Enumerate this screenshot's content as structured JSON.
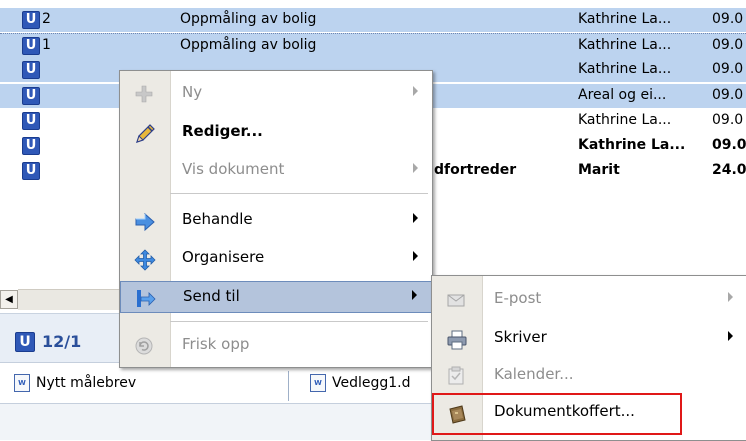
{
  "list": {
    "rows": [
      {
        "badge": "U",
        "num": "2",
        "title": "Oppmåling av bolig",
        "who": "Kathrine La...",
        "date": "09.0",
        "selected": true,
        "bold": false
      },
      {
        "badge": "U",
        "num": "1",
        "title": "Oppmåling av bolig",
        "who": "Kathrine La...",
        "date": "09.0",
        "selected": true,
        "bold": false
      },
      {
        "badge": "U",
        "num": "",
        "title": "",
        "who": "Kathrine La...",
        "date": "09.0",
        "selected": true,
        "bold": false
      },
      {
        "badge": "U",
        "num": "",
        "title": "",
        "who": "Areal og ei...",
        "date": "09.0",
        "selected": true,
        "bold": false
      },
      {
        "badge": "U",
        "num": "",
        "title": "",
        "who": "Kathrine La...",
        "date": "09.0",
        "selected": false,
        "bold": false
      },
      {
        "badge": "U",
        "num": "",
        "title": "",
        "who": "Kathrine La...",
        "date": "09.0",
        "selected": false,
        "bold": true
      },
      {
        "badge": "U",
        "num": "",
        "title": "dfortreder",
        "who": "Marit",
        "date": "24.0",
        "selected": false,
        "bold": true
      }
    ]
  },
  "lower": {
    "badge": "U",
    "number": "12/1",
    "attachments": [
      {
        "icon": "word-document-icon",
        "label": "Nytt målebrev"
      },
      {
        "icon": "word-document-icon",
        "label": "Vedlegg1.d"
      }
    ]
  },
  "context_menu": {
    "items": [
      {
        "name": "new",
        "icon": "plus-icon",
        "label": "Ny",
        "disabled": true,
        "submenu": true
      },
      {
        "name": "edit",
        "icon": "pencil-icon",
        "label": "Rediger...",
        "disabled": false,
        "strong": true,
        "submenu": false
      },
      {
        "name": "view-document",
        "icon": "",
        "label": "Vis dokument",
        "disabled": true,
        "submenu": true
      },
      {
        "name": "process",
        "icon": "arrow-right-icon",
        "label": "Behandle",
        "disabled": false,
        "submenu": true
      },
      {
        "name": "organize",
        "icon": "move-icon",
        "label": "Organisere",
        "disabled": false,
        "submenu": true
      },
      {
        "name": "send-to",
        "icon": "send-to-icon",
        "label": "Send til",
        "disabled": false,
        "submenu": true,
        "highlighted": true
      },
      {
        "name": "refresh",
        "icon": "refresh-icon",
        "label": "Frisk opp",
        "disabled": true,
        "submenu": false
      }
    ]
  },
  "submenu": {
    "items": [
      {
        "name": "email",
        "icon": "envelope-icon",
        "label": "E-post",
        "disabled": true,
        "submenu": true
      },
      {
        "name": "printer",
        "icon": "printer-icon",
        "label": "Skriver",
        "disabled": false,
        "submenu": true
      },
      {
        "name": "calendar",
        "icon": "calendar-icon",
        "label": "Kalender...",
        "disabled": true,
        "submenu": false
      },
      {
        "name": "briefcase",
        "icon": "briefcase-icon",
        "label": "Dokumentkoffert...",
        "disabled": false,
        "submenu": false,
        "outlined": true
      }
    ]
  },
  "colors": {
    "selection": "#bcd3ef",
    "badge": "#2f58b7",
    "menu_highlight": "#b4c4dc",
    "annotation_red": "#e01818"
  }
}
